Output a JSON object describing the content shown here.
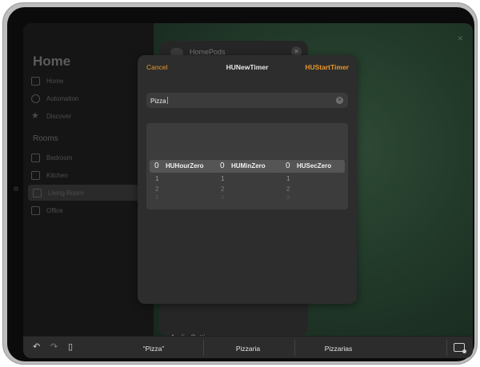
{
  "sidebar": {
    "title": "Home",
    "items": [
      {
        "label": "Home",
        "icon": "house-icon"
      },
      {
        "label": "Automation",
        "icon": "clock-icon"
      },
      {
        "label": "Discover",
        "icon": "star-icon"
      }
    ],
    "rooms_header": "Rooms",
    "rooms": [
      {
        "label": "Bedroom"
      },
      {
        "label": "Kitchen"
      },
      {
        "label": "Living Room"
      },
      {
        "label": "Office"
      }
    ]
  },
  "background_panel": {
    "title": "HomePods",
    "audio_settings": "Audio Settings"
  },
  "modal": {
    "cancel_label": "Cancel",
    "title": "HUNewTimer",
    "start_label": "HUStartTimer",
    "search_value": "Pizza",
    "picker": {
      "hours": {
        "selected": "0",
        "unit": "HUHourZero",
        "next": [
          "1",
          "2",
          "3"
        ]
      },
      "minutes": {
        "selected": "0",
        "unit": "HUMinZero",
        "next": [
          "1",
          "2",
          "3"
        ]
      },
      "seconds": {
        "selected": "0",
        "unit": "HUSecZero",
        "next": [
          "1",
          "2",
          "3"
        ]
      }
    }
  },
  "keyboard_bar": {
    "suggestions": [
      "“Pizza”",
      "Pizzaria",
      "Pizzarias"
    ]
  },
  "colors": {
    "accent": "#e8972d",
    "modal_bg": "#2d2d2d",
    "background_green": "#223a2a"
  }
}
